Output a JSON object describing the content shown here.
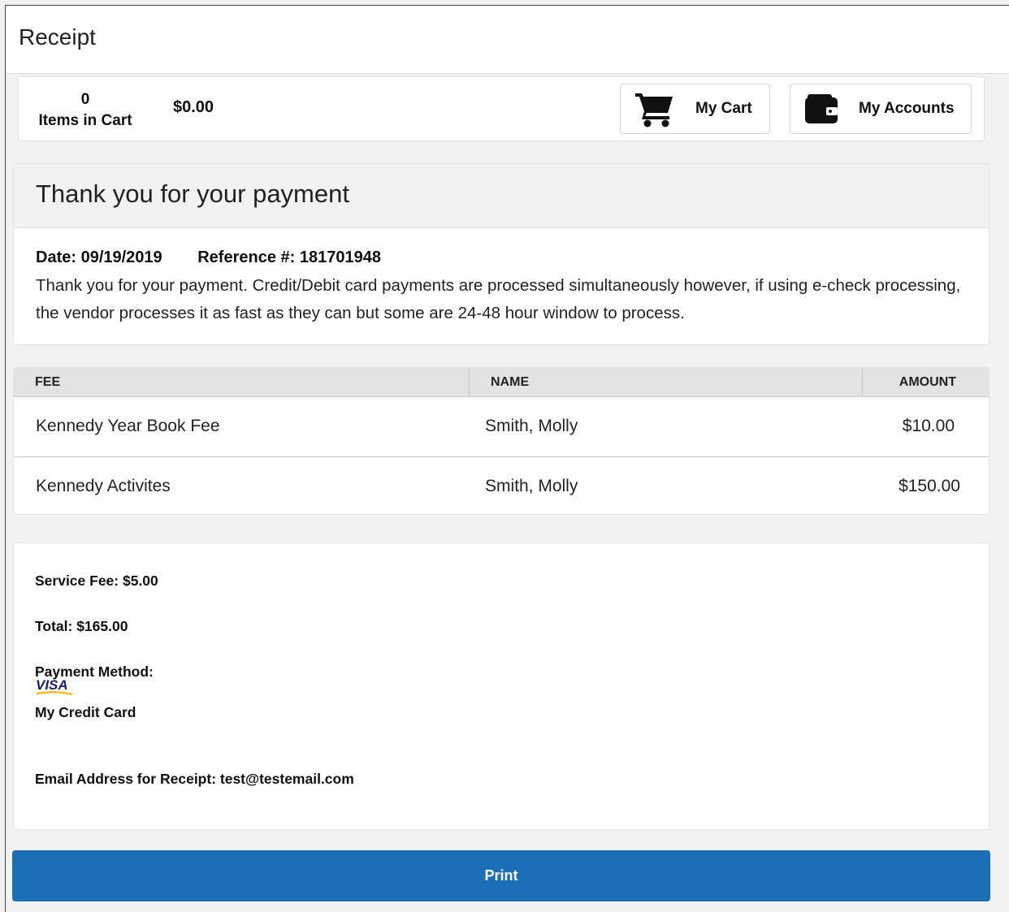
{
  "header": {
    "title": "Receipt"
  },
  "cart": {
    "count": "0",
    "items_label": "Items in Cart",
    "total": "$0.00",
    "my_cart_label": "My Cart",
    "my_accounts_label": "My Accounts"
  },
  "confirmation": {
    "heading": "Thank you for your payment",
    "date": "Date: 09/19/2019",
    "reference": "Reference #: 181701948",
    "message": "Thank you for your payment.  Credit/Debit card payments are processed simultaneously however, if using e-check processing, the vendor processes it as fast as they can but some are 24-48 hour window to process."
  },
  "table": {
    "headers": {
      "fee": "FEE",
      "name": "NAME",
      "amount": "AMOUNT"
    },
    "rows": [
      {
        "fee": "Kennedy Year Book Fee",
        "name": "Smith, Molly",
        "amount": "$10.00"
      },
      {
        "fee": "Kennedy Activites",
        "name": "Smith, Molly",
        "amount": "$150.00"
      }
    ]
  },
  "summary": {
    "service_fee": "Service Fee: $5.00",
    "total": "Total: $165.00",
    "payment_method_label": "Payment Method:",
    "card_brand": "VISA",
    "card_name": "My Credit Card",
    "email": "Email Address for Receipt: test@testemail.com"
  },
  "actions": {
    "print_label": "Print"
  },
  "colors": {
    "primary": "#1a6fb6",
    "visa_blue": "#1a1f71",
    "visa_gold": "#f7b600"
  }
}
